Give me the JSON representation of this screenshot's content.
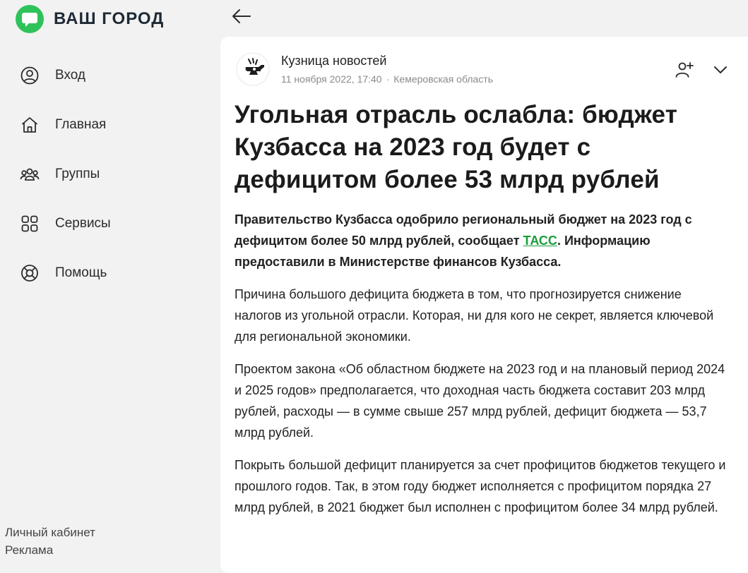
{
  "brand": {
    "name": "ВАШ ГОРОД",
    "accent_color": "#2ec25b"
  },
  "sidebar": {
    "items": [
      {
        "label": "Вход",
        "icon": "user-circle-icon"
      },
      {
        "label": "Главная",
        "icon": "home-icon"
      },
      {
        "label": "Группы",
        "icon": "group-icon"
      },
      {
        "label": "Сервисы",
        "icon": "grid-icon"
      },
      {
        "label": "Помощь",
        "icon": "lifebuoy-icon"
      }
    ],
    "footer": {
      "account": "Личный кабинет",
      "ads": "Реклама"
    }
  },
  "article": {
    "author": "Кузница новостей",
    "date": "11 ноября 2022, 17:40",
    "region": "Кемеровская область",
    "title": "Угольная отрасль ослабла: бюджет Кузбасса на 2023 год будет с дефицитом более 53 млрд рублей",
    "lead_before": "Правительство Кузбасса одобрило региональный бюджет на 2023 год с дефицитом более 50 млрд рублей, сообщает ",
    "lead_link": "ТАСС",
    "lead_after": ". Информацию предоставили в Министерстве финансов Кузбасса.",
    "paragraphs": [
      "Причина большого дефицита бюджета в том, что прогнозируется снижение налогов из угольной отрасли. Которая, ни для кого не секрет, является ключевой для региональной экономики.",
      "Проектом закона «Об областном бюджете на 2023 год и на плановый период 2024 и 2025 годов» предполагается, что доходная часть бюджета составит 203 млрд рублей, расходы — в сумме свыше 257 млрд рублей, дефицит бюджета — 53,7 млрд рублей.",
      "Покрыть большой дефицит планируется за счет профицитов бюджетов текущего и прошлого годов. Так, в этом году бюджет исполняется с профицитом порядка 27 млрд рублей, в 2021 бюджет был исполнен с профицитом более 34 млрд рублей."
    ],
    "link_color": "#1a9d3c"
  }
}
